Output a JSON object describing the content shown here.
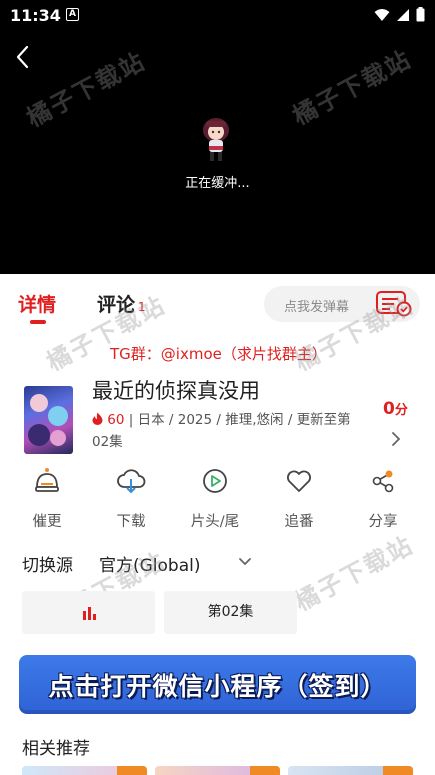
{
  "status_bar": {
    "time": "11:34",
    "notification_badge": "A",
    "icons": [
      "wifi-icon",
      "signal-icon",
      "battery-icon"
    ]
  },
  "player": {
    "buffering_text": "正在缓冲..."
  },
  "watermark": "橘子下载站",
  "tabs": {
    "details_label": "详情",
    "comments_label": "评论",
    "comments_count": "1"
  },
  "danmaku": {
    "placeholder": "点我发弹幕"
  },
  "tg_notice": "TG群：@ixmoe（求片找群主）",
  "anime": {
    "title": "最近的侦探真没用",
    "hot_count": "60",
    "meta_rest": " | 日本 / 2025 / 推理,悠闲 / 更新至第02集",
    "score_value": "0",
    "score_unit": "分"
  },
  "actions": [
    {
      "label": "催更",
      "icon": "bell-icon"
    },
    {
      "label": "下载",
      "icon": "cloud-download-icon"
    },
    {
      "label": "片头/尾",
      "icon": "play-circle-icon"
    },
    {
      "label": "追番",
      "icon": "heart-icon"
    },
    {
      "label": "分享",
      "icon": "share-icon"
    }
  ],
  "source": {
    "label": "切换源",
    "value": "官方(Global)"
  },
  "episodes": {
    "current": "第02集"
  },
  "banner": {
    "text": "点击打开微信小程序（签到）"
  },
  "related": {
    "title": "相关推荐"
  },
  "colors": {
    "accent": "#e02020",
    "banner_blue": "#2f62d6"
  }
}
